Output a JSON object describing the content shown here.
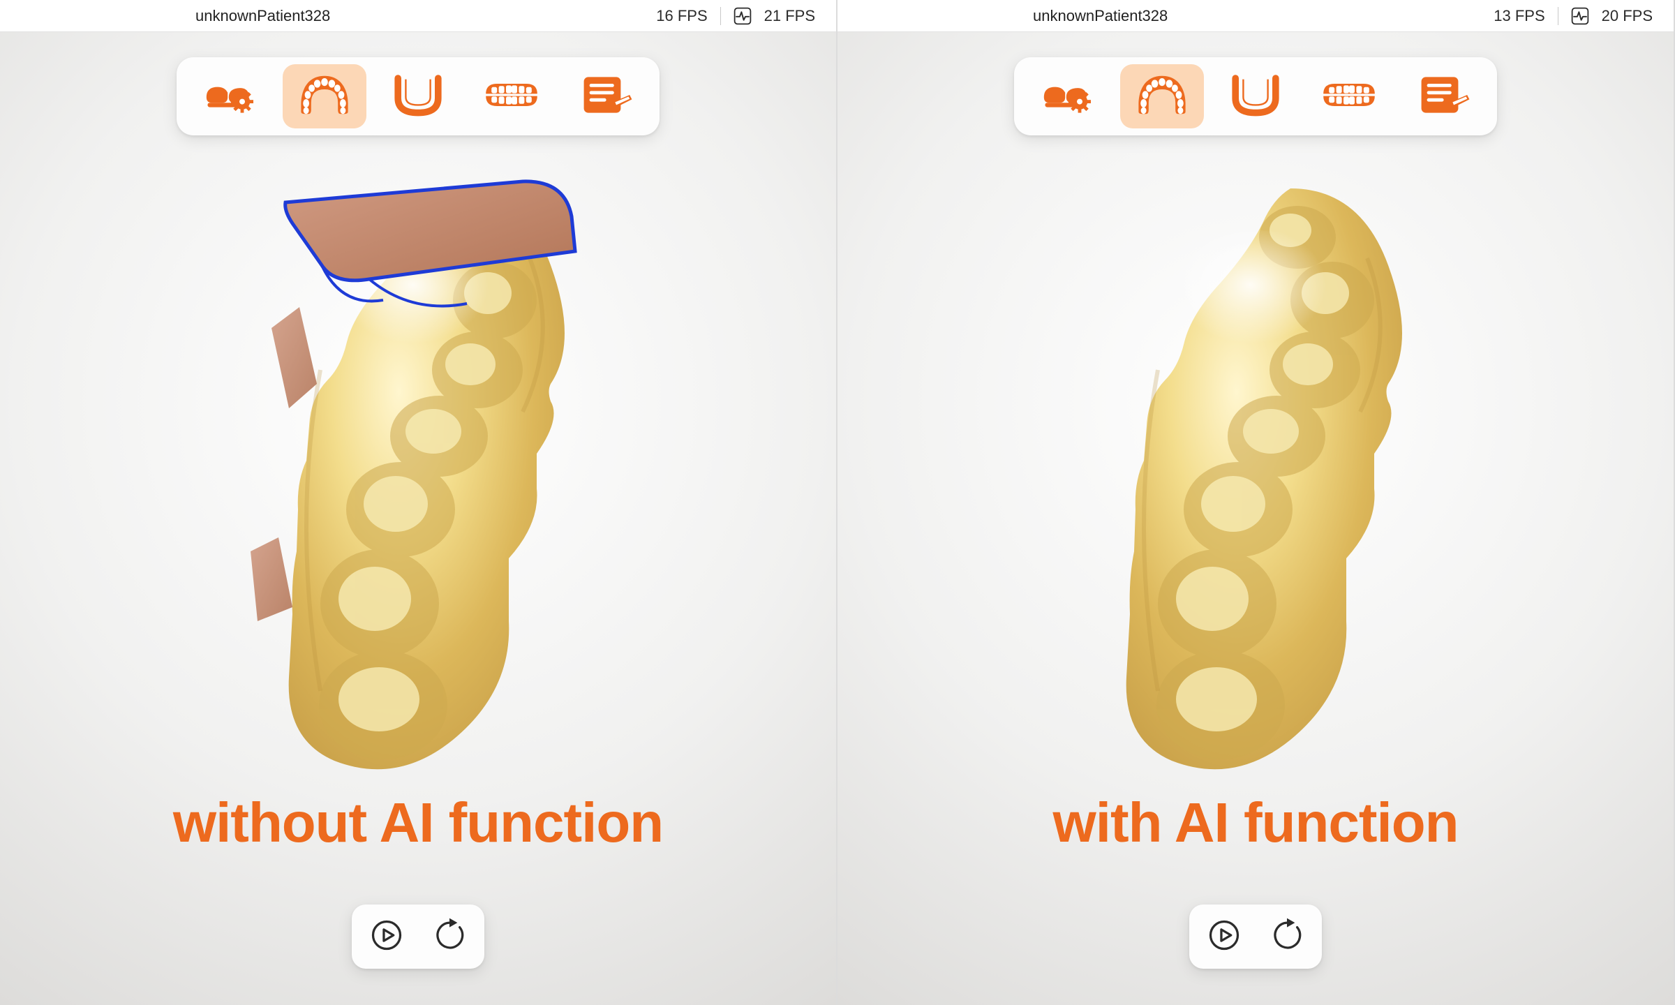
{
  "panels": [
    {
      "header": {
        "patient": "unknownPatient328",
        "fps_primary": "16 FPS",
        "fps_secondary": "21 FPS"
      },
      "caption": "without AI function"
    },
    {
      "header": {
        "patient": "unknownPatient328",
        "fps_primary": "13 FPS",
        "fps_secondary": "20 FPS"
      },
      "caption": "with AI function"
    }
  ],
  "toolbar_items": [
    {
      "name": "scan-setup-icon",
      "selected": false
    },
    {
      "name": "upper-arch-icon",
      "selected": true
    },
    {
      "name": "lower-arch-icon",
      "selected": false
    },
    {
      "name": "bite-icon",
      "selected": false
    },
    {
      "name": "order-form-icon",
      "selected": false
    }
  ],
  "controls": [
    {
      "name": "play-button"
    },
    {
      "name": "reset-button"
    }
  ],
  "colors": {
    "accent": "#ed6a1e",
    "caption": "#ed6a1e",
    "toolbar_selected_bg": "#fcd7b6"
  }
}
